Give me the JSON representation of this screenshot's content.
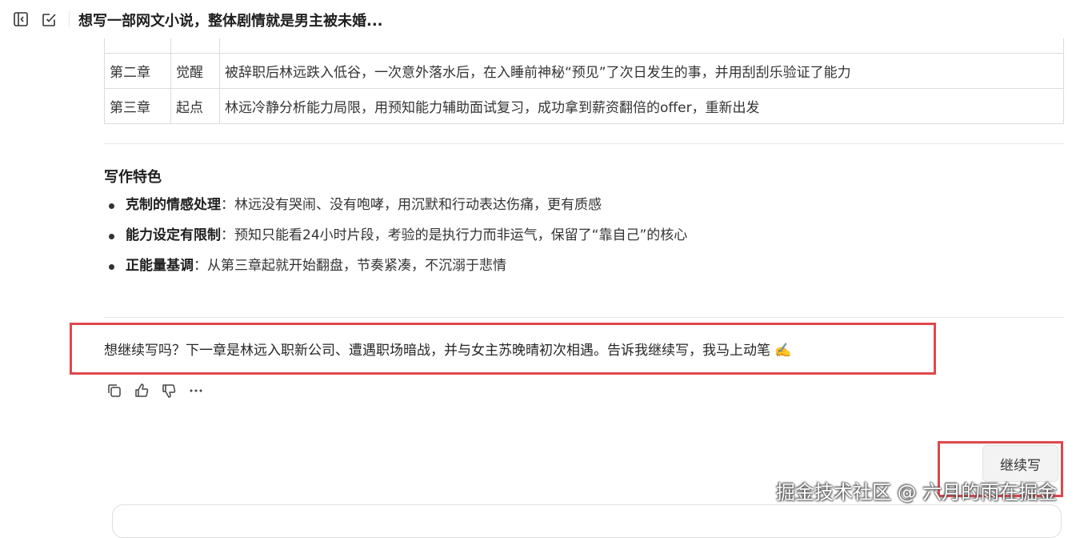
{
  "header": {
    "title": "想写一部网文小说，整体剧情就是男主被未婚..."
  },
  "chapters": [
    {
      "chapter": "第二章",
      "name": "觉醒",
      "summary": "被辞职后林远跌入低谷，一次意外落水后，在入睡前神秘“预见”了次日发生的事，并用刮刮乐验证了能力"
    },
    {
      "chapter": "第三章",
      "name": "起点",
      "summary": "林远冷静分析能力局限，用预知能力辅助面试复习，成功拿到薪资翻倍的offer，重新出发"
    }
  ],
  "features": {
    "title": "写作特色",
    "items": [
      {
        "label": "克制的情感处理",
        "text": "：林远没有哭闹、没有咆哮，用沉默和行动表达伤痛，更有质感"
      },
      {
        "label": "能力设定有限制",
        "text": "：预知只能看24小时片段，考验的是执行力而非运气，保留了“靠自己”的核心"
      },
      {
        "label": "正能量基调",
        "text": "：从第三章起就开始翻盘，节奏紧凑，不沉溺于悲情"
      }
    ]
  },
  "followup": "想继续写吗？下一章是林远入职新公司、遭遇职场暗战，并与女主苏晚晴初次相遇。告诉我继续写，我马上动笔 ✍️",
  "actions": [
    "copy-icon",
    "thumbs-up-icon",
    "thumbs-down-icon",
    "more-icon"
  ],
  "continue_button": "继续写",
  "watermark": "掘金技术社区 @ 六月的雨在掘金",
  "colors": {
    "highlight": "#e0474c"
  }
}
